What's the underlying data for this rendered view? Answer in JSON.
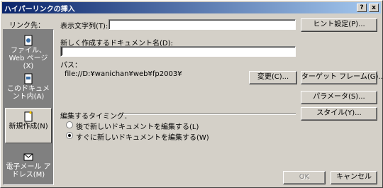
{
  "window": {
    "title": "ハイパーリンクの挿入",
    "help_label": "?",
    "close_label": "x"
  },
  "linkbar": {
    "label": "リンク先：",
    "items": [
      {
        "label": "ファイル、Web ページ(X)",
        "icon": "web-page-icon",
        "active": false
      },
      {
        "label": "このドキュメント内(A)",
        "icon": "document-icon",
        "active": false
      },
      {
        "label": "新規作成(N)",
        "icon": "new-document-icon",
        "active": true
      },
      {
        "label": "電子メール アドレス(M)",
        "icon": "email-icon",
        "active": false
      }
    ]
  },
  "display_text": {
    "label": "表示文字列(T):",
    "value": ""
  },
  "new_doc": {
    "label": "新しく作成するドキュメント名(D):",
    "value": ""
  },
  "path": {
    "label": "パス：",
    "value": "file://D:¥wanichan¥web¥fp2003¥"
  },
  "edit_timing": {
    "label": "編集するタイミング：",
    "options": [
      {
        "label": "後で新しいドキュメントを編集する(L)",
        "checked": false
      },
      {
        "label": "すぐに新しいドキュメントを編集する(W)",
        "checked": true
      }
    ]
  },
  "buttons": {
    "hint": "ヒント設定(P)...",
    "change": "変更(C)...",
    "target_frame": "ターゲット フレーム(G)...",
    "parameters": "パラメータ(S)...",
    "style": "スタイル(Y)...",
    "ok": "OK",
    "cancel": "キャンセル"
  }
}
